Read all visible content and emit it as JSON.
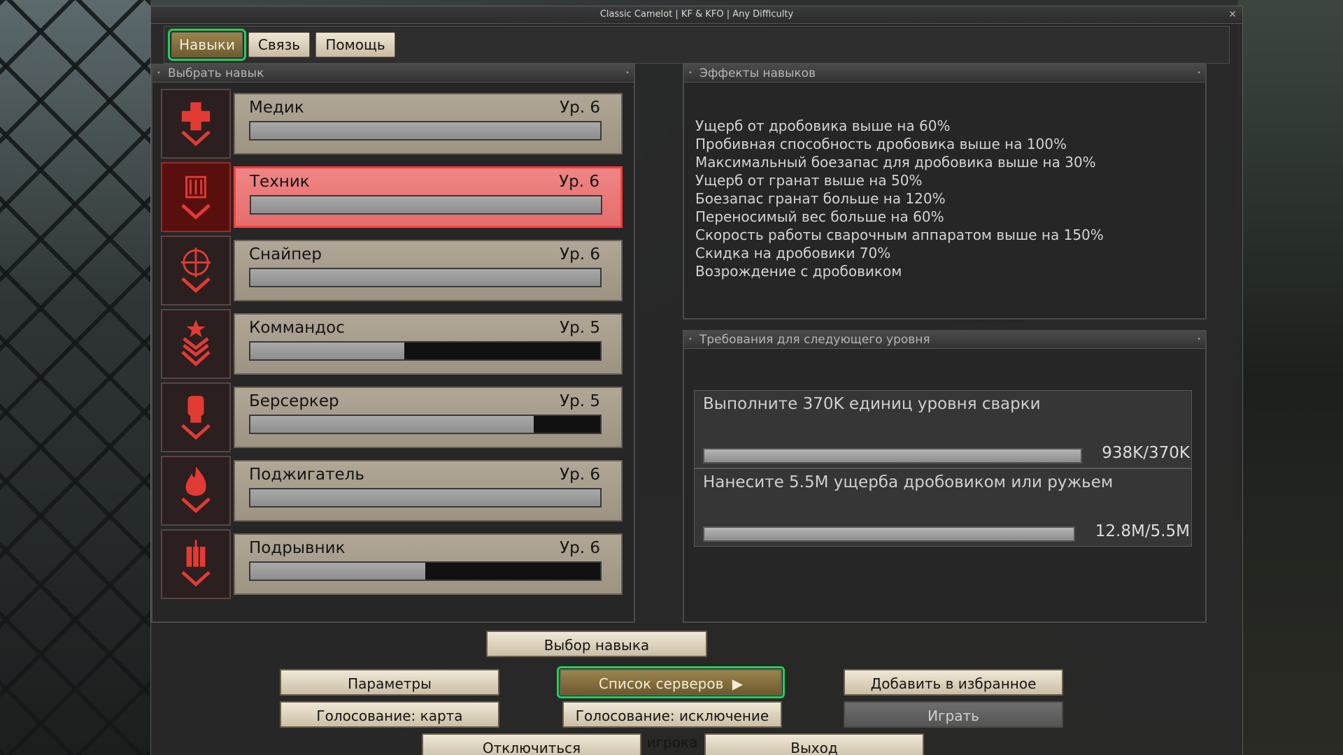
{
  "window": {
    "title": "Classic Camelot | KF & KFO | Any Difficulty",
    "close_glyph": "✕"
  },
  "tabs": [
    {
      "label": "Навыки",
      "active": true
    },
    {
      "label": "Связь",
      "active": false
    },
    {
      "label": "Помощь",
      "active": false
    }
  ],
  "perk_panel": {
    "title": "Выбрать навык",
    "perks": [
      {
        "name": "Медик",
        "level": "Ур. 6",
        "progress": 1.0,
        "icon": "medic-icon",
        "selected": false
      },
      {
        "name": "Техник",
        "level": "Ур. 6",
        "progress": 1.0,
        "icon": "support-icon",
        "selected": true
      },
      {
        "name": "Снайпер",
        "level": "Ур. 6",
        "progress": 1.0,
        "icon": "sharpshooter-icon",
        "selected": false
      },
      {
        "name": "Коммандос",
        "level": "Ур. 5",
        "progress": 0.44,
        "icon": "commando-icon",
        "selected": false
      },
      {
        "name": "Берсеркер",
        "level": "Ур. 5",
        "progress": 0.81,
        "icon": "berserker-icon",
        "selected": false
      },
      {
        "name": "Поджигатель",
        "level": "Ур. 6",
        "progress": 1.0,
        "icon": "firebug-icon",
        "selected": false
      },
      {
        "name": "Подрывник",
        "level": "Ур. 6",
        "progress": 0.5,
        "icon": "demolitions-icon",
        "selected": false
      }
    ]
  },
  "effects_panel": {
    "title": "Эффекты навыков",
    "lines": [
      "Ущерб от дробовика выше на 60%",
      "Пробивная способность дробовика выше на 100%",
      "Максимальный боезапас для дробовика выше на 30%",
      "Ущерб от гранат выше на 50%",
      "Боезапас гранат больше на 120%",
      "Переносимый вес больше на 60%",
      "Скорость работы сварочным аппаратом выше на 150%",
      "Скидка на дробовики 70%",
      "Возрождение с дробовиком"
    ]
  },
  "requirements_panel": {
    "title": "Требования для следующего уровня",
    "items": [
      {
        "text": "Выполните 370K единиц уровня сварки",
        "value": "938K/370K",
        "progress": 1.0
      },
      {
        "text": "Нанесите 5.5M ущерба дробовиком или ружьем",
        "value": "12.8M/5.5M",
        "progress": 1.0
      }
    ]
  },
  "buttons": {
    "select_perk": "Выбор навыка",
    "settings": "Параметры",
    "server_list": "Список серверов",
    "add_favorite": "Добавить в избранное",
    "vote_map": "Голосование: карта",
    "vote_kick": "Голосование: исключение игрока",
    "play": "Играть",
    "disconnect": "Отключиться",
    "exit": "Выход"
  },
  "colors": {
    "accent_green": "#1fd05b",
    "selected_red": "#e66d6d",
    "icon_red": "#e23b34"
  }
}
